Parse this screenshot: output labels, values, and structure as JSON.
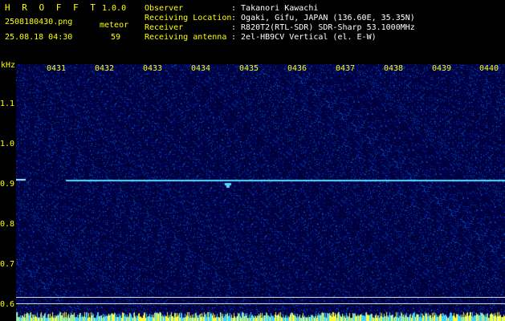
{
  "app": {
    "name": "H R O F F T",
    "version": "1.0.0"
  },
  "file": {
    "name": "2508180430.png",
    "datetime": "25.08.18 04:30"
  },
  "meteor": {
    "label": "meteor",
    "count": "59"
  },
  "info": {
    "labels": [
      "Observer",
      "Receiving Location",
      "Receiver",
      "Receiving antenna"
    ],
    "values": [
      ": Takanori Kawachi",
      ": Ogaki, Gifu, JAPAN (136.60E, 35.35N)",
      ": R820T2(RTL-SDR) SDR-Sharp 53.1000MHz",
      ": 2el-HB9CV Vertical (el. E-W)"
    ]
  },
  "axis": {
    "y_unit": "kHz",
    "y_ticks": [
      "1.1",
      "1.0",
      "0.9",
      "0.8",
      "0.7",
      "0.6"
    ],
    "x_ticks": [
      "0431",
      "0432",
      "0433",
      "0434",
      "0435",
      "0436",
      "0437",
      "0438",
      "0439",
      "0440"
    ]
  },
  "colors": {
    "text": "#ffff00",
    "label_white": "#ffffff",
    "noise_bg": "#000060",
    "signal": "#5ad8ff"
  }
}
